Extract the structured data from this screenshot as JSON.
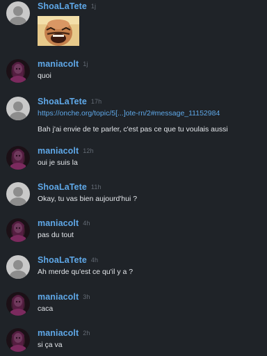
{
  "users": {
    "shoa": {
      "name": "ShoaLaTete",
      "avatar_icon": "shoa-avatar-icon",
      "color": "#5fa8e8"
    },
    "mania": {
      "name": "maniacolt",
      "avatar_icon": "maniacolt-avatar-icon",
      "color": "#5fa8e8"
    }
  },
  "messages": [
    {
      "author": "ShoaLaTete",
      "time": "1j",
      "sticker": "laughing-man-sticker"
    },
    {
      "author": "maniacolt",
      "time": "1j",
      "text": "quoi"
    },
    {
      "author": "ShoaLaTete",
      "time": "17h",
      "link": "https://onche.org/topic/5[...]ote-rn/2#message_11152984",
      "text": "Bah j'ai envie de te parler, c'est pas ce que tu voulais aussi"
    },
    {
      "author": "maniacolt",
      "time": "12h",
      "text": "oui je suis la"
    },
    {
      "author": "ShoaLaTete",
      "time": "11h",
      "text": "Okay, tu vas bien aujourd'hui ?"
    },
    {
      "author": "maniacolt",
      "time": "4h",
      "text": "pas du tout"
    },
    {
      "author": "ShoaLaTete",
      "time": "4h",
      "text": "Ah merde qu'est ce qu'il y a ?"
    },
    {
      "author": "maniacolt",
      "time": "3h",
      "text": "caca"
    },
    {
      "author": "maniacolt",
      "time": "2h",
      "text": "si ça va"
    }
  ],
  "colors": {
    "background": "#1f2328",
    "username": "#5fa8e8",
    "timestamp": "#646b75",
    "text": "#e3e6ea"
  }
}
